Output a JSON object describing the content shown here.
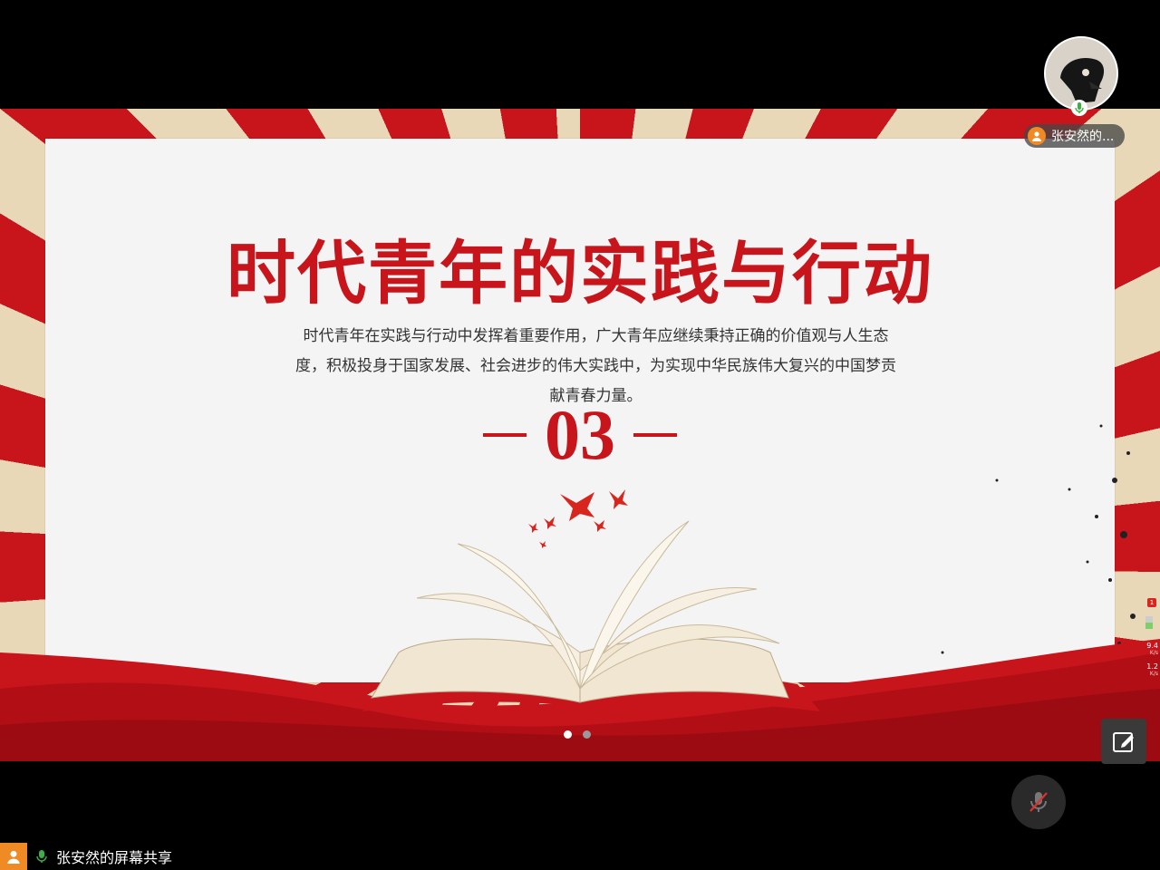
{
  "slide": {
    "title": "时代青年的实践与行动",
    "body": "时代青年在实践与行动中发挥着重要作用，广大青年应继续秉持正确的价值观与人生态度，积极投身于国家发展、社会进步的伟大实践中，为实现中华民族伟大复兴的中国梦贡献青春力量。",
    "section_number": "03",
    "pager": {
      "total": 2,
      "active_index": 0
    }
  },
  "participant": {
    "name": "张安然的...",
    "mic_active": true
  },
  "network": {
    "badge": "1",
    "upload_value": "9.4",
    "upload_unit": "K/s",
    "download_value": "1.2",
    "download_unit": "K/s"
  },
  "share_bar": {
    "label": "张安然的屏幕共享"
  },
  "controls": {
    "annotate_icon": "annotate-icon",
    "mic_muted": true
  },
  "colors": {
    "brand_red": "#c8141b",
    "stripe_cream": "#e9d8b8",
    "accent_orange": "#f08a24"
  }
}
